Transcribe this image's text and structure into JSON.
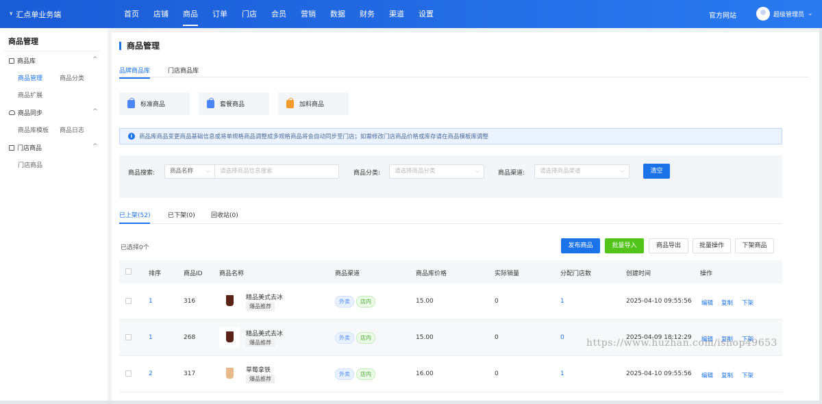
{
  "app": {
    "logo_mark": "ᵞ",
    "name": "汇点单业务端"
  },
  "nav": [
    "首页",
    "店铺",
    "商品",
    "订单",
    "门店",
    "会员",
    "营销",
    "数据",
    "财务",
    "渠道",
    "设置"
  ],
  "nav_active": "商品",
  "header": {
    "official": "官方网站",
    "user": "超级管理员",
    "user_chevron": "⌄"
  },
  "sidebar": {
    "title": "商品管理",
    "groups": [
      {
        "label": "商品库",
        "items": [
          "商品管理",
          "商品分类",
          "商品扩展"
        ]
      },
      {
        "label": "商品同步",
        "items": [
          "商品库模板",
          "商品日志"
        ]
      },
      {
        "label": "门店商品",
        "items": [
          "门店商品"
        ]
      }
    ],
    "chevron": "^",
    "active_item": "商品管理"
  },
  "page": {
    "title": "商品管理",
    "lib_tabs": [
      "品牌商品库",
      "门店商品库"
    ],
    "cards": [
      "标准商品",
      "套餐商品",
      "加料商品"
    ],
    "notice": "商品库商品变更商品基础信息或将单规格商品调整成多规格商品将会自动同步至门店；如需修改门店商品价格或库存请在商品模板库调整",
    "notice_icon": "i"
  },
  "filter": {
    "search_label": "商品搜索:",
    "search_type": "商品名称",
    "search_placeholder": "请选择商品信息搜索",
    "category_label": "商品分类:",
    "category_placeholder": "请选择商品分类",
    "channel_label": "商品渠道:",
    "channel_placeholder": "请选择商品渠道",
    "clear": "清空",
    "arrow": "⌵"
  },
  "status_tabs": [
    "已上架(52)",
    "已下架(0)",
    "回收站(0)"
  ],
  "selected_count": "已选择0个",
  "actions": [
    "发布商品",
    "批量导入",
    "商品导出",
    "批量操作",
    "下架商品"
  ],
  "table": {
    "headers": [
      "排序",
      "商品ID",
      "商品名称",
      "商品渠道",
      "商品库价格",
      "实际销量",
      "分配门店数",
      "创建时间",
      "操作"
    ],
    "rows": [
      {
        "sort": "1",
        "id": "316",
        "name": "精品美式去冰",
        "tag": "爆品推荐",
        "channels": [
          "外卖",
          "店内"
        ],
        "price": "15.00",
        "sales": "0",
        "stores": "1",
        "created": "2025-04-10 09:55:56",
        "ops": [
          "编辑",
          "复制",
          "下架"
        ],
        "cup_color": "#5a2316"
      },
      {
        "sort": "1",
        "id": "268",
        "name": "精品美式去冰",
        "tag": "爆品推荐",
        "channels": [
          "外卖",
          "店内"
        ],
        "price": "15.00",
        "sales": "0",
        "stores": "0",
        "created": "2025-04-09 18:12:29",
        "ops": [
          "编辑",
          "复制",
          "下架"
        ],
        "cup_color": "#5a2316"
      },
      {
        "sort": "2",
        "id": "317",
        "name": "草莓拿铁",
        "tag": "爆品推荐",
        "channels": [
          "外卖",
          "店内"
        ],
        "price": "16.00",
        "sales": "0",
        "stores": "1",
        "created": "2025-04-10 09:55:56",
        "ops": [
          "编辑",
          "复制",
          "下架"
        ],
        "cup_color": "#e8b98a"
      }
    ]
  },
  "watermark": "https://www.huzhan.com/ishop49653"
}
